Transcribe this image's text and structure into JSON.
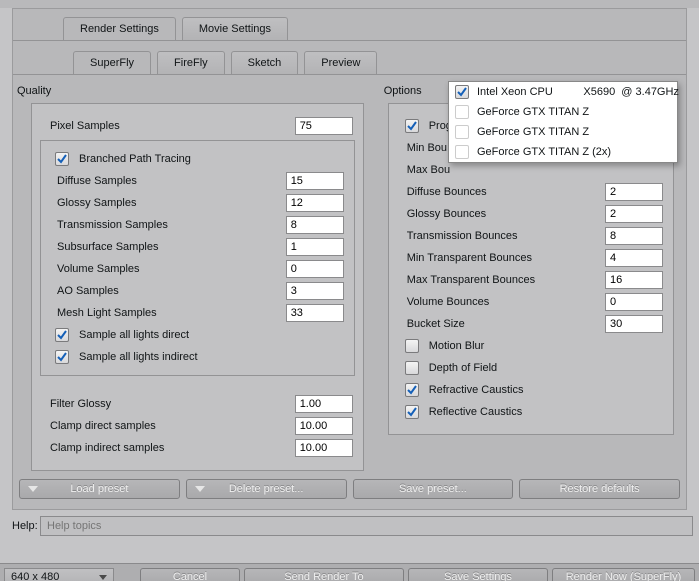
{
  "tabs_outer": [
    "Render Settings",
    "Movie Settings"
  ],
  "tabs_inner": [
    "SuperFly",
    "FireFly",
    "Sketch",
    "Preview"
  ],
  "active_outer": 0,
  "active_inner": 0,
  "quality": {
    "title": "Quality",
    "pixel_samples_label": "Pixel Samples",
    "pixel_samples": "75",
    "branched_label": "Branched Path Tracing",
    "branched_checked": true,
    "diffuse_samples_label": "Diffuse Samples",
    "diffuse_samples": "15",
    "glossy_samples_label": "Glossy Samples",
    "glossy_samples": "12",
    "transmission_samples_label": "Transmission Samples",
    "transmission_samples": "8",
    "subsurface_samples_label": "Subsurface Samples",
    "subsurface_samples": "1",
    "volume_samples_label": "Volume Samples",
    "volume_samples": "0",
    "ao_samples_label": "AO Samples",
    "ao_samples": "3",
    "mesh_light_samples_label": "Mesh Light Samples",
    "mesh_light_samples": "33",
    "sample_all_direct_label": "Sample all lights direct",
    "sample_all_direct": true,
    "sample_all_indirect_label": "Sample all lights indirect",
    "sample_all_indirect": true,
    "filter_glossy_label": "Filter Glossy",
    "filter_glossy": "1.00",
    "clamp_direct_label": "Clamp direct samples",
    "clamp_direct": "10.00",
    "clamp_indirect_label": "Clamp indirect samples",
    "clamp_indirect": "10.00"
  },
  "dropdown": {
    "items": [
      {
        "label": "Intel Xeon CPU          X5690  @ 3.47GHz",
        "checked": true
      },
      {
        "label": "GeForce GTX TITAN Z",
        "checked": false
      },
      {
        "label": "GeForce GTX TITAN Z",
        "checked": false
      },
      {
        "label": "GeForce GTX TITAN Z (2x)",
        "checked": false
      }
    ]
  },
  "options": {
    "title": "Options",
    "prog_checked": true,
    "prog_label": "Prog",
    "min_bou_label": "Min Bou",
    "max_bou_label": "Max Bou",
    "diffuse_bounces_label": "Diffuse Bounces",
    "diffuse_bounces": "2",
    "glossy_bounces_label": "Glossy Bounces",
    "glossy_bounces": "2",
    "transmission_bounces_label": "Transmission Bounces",
    "transmission_bounces": "8",
    "min_trans_label": "Min Transparent Bounces",
    "min_trans": "4",
    "max_trans_label": "Max Transparent Bounces",
    "max_trans": "16",
    "volume_bounces_label": "Volume Bounces",
    "volume_bounces": "0",
    "bucket_size_label": "Bucket Size",
    "bucket_size": "30",
    "motion_blur_label": "Motion Blur",
    "motion_blur": false,
    "dof_label": "Depth of Field",
    "dof": false,
    "refractive_label": "Refractive Caustics",
    "refractive": true,
    "reflective_label": "Reflective Caustics",
    "reflective": true
  },
  "preset_bar": {
    "load": "Load preset",
    "delete": "Delete preset...",
    "save": "Save preset...",
    "restore": "Restore defaults"
  },
  "help": {
    "label": "Help:",
    "placeholder": "Help topics"
  },
  "footer": {
    "resolution": "640 x 480",
    "cancel": "Cancel",
    "send": "Send Render To",
    "save": "Save Settings",
    "render": "Render Now (SuperFly)"
  }
}
